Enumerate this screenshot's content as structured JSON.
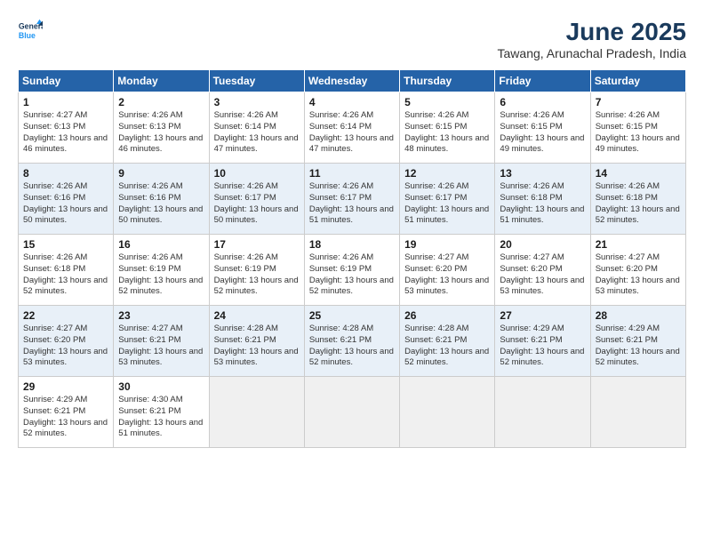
{
  "logo": {
    "line1": "General",
    "line2": "Blue"
  },
  "title": "June 2025",
  "location": "Tawang, Arunachal Pradesh, India",
  "headers": [
    "Sunday",
    "Monday",
    "Tuesday",
    "Wednesday",
    "Thursday",
    "Friday",
    "Saturday"
  ],
  "weeks": [
    [
      {
        "day": "1",
        "info": "Sunrise: 4:27 AM\nSunset: 6:13 PM\nDaylight: 13 hours and 46 minutes."
      },
      {
        "day": "2",
        "info": "Sunrise: 4:26 AM\nSunset: 6:13 PM\nDaylight: 13 hours and 46 minutes."
      },
      {
        "day": "3",
        "info": "Sunrise: 4:26 AM\nSunset: 6:14 PM\nDaylight: 13 hours and 47 minutes."
      },
      {
        "day": "4",
        "info": "Sunrise: 4:26 AM\nSunset: 6:14 PM\nDaylight: 13 hours and 47 minutes."
      },
      {
        "day": "5",
        "info": "Sunrise: 4:26 AM\nSunset: 6:15 PM\nDaylight: 13 hours and 48 minutes."
      },
      {
        "day": "6",
        "info": "Sunrise: 4:26 AM\nSunset: 6:15 PM\nDaylight: 13 hours and 49 minutes."
      },
      {
        "day": "7",
        "info": "Sunrise: 4:26 AM\nSunset: 6:15 PM\nDaylight: 13 hours and 49 minutes."
      }
    ],
    [
      {
        "day": "8",
        "info": "Sunrise: 4:26 AM\nSunset: 6:16 PM\nDaylight: 13 hours and 50 minutes."
      },
      {
        "day": "9",
        "info": "Sunrise: 4:26 AM\nSunset: 6:16 PM\nDaylight: 13 hours and 50 minutes."
      },
      {
        "day": "10",
        "info": "Sunrise: 4:26 AM\nSunset: 6:17 PM\nDaylight: 13 hours and 50 minutes."
      },
      {
        "day": "11",
        "info": "Sunrise: 4:26 AM\nSunset: 6:17 PM\nDaylight: 13 hours and 51 minutes."
      },
      {
        "day": "12",
        "info": "Sunrise: 4:26 AM\nSunset: 6:17 PM\nDaylight: 13 hours and 51 minutes."
      },
      {
        "day": "13",
        "info": "Sunrise: 4:26 AM\nSunset: 6:18 PM\nDaylight: 13 hours and 51 minutes."
      },
      {
        "day": "14",
        "info": "Sunrise: 4:26 AM\nSunset: 6:18 PM\nDaylight: 13 hours and 52 minutes."
      }
    ],
    [
      {
        "day": "15",
        "info": "Sunrise: 4:26 AM\nSunset: 6:18 PM\nDaylight: 13 hours and 52 minutes."
      },
      {
        "day": "16",
        "info": "Sunrise: 4:26 AM\nSunset: 6:19 PM\nDaylight: 13 hours and 52 minutes."
      },
      {
        "day": "17",
        "info": "Sunrise: 4:26 AM\nSunset: 6:19 PM\nDaylight: 13 hours and 52 minutes."
      },
      {
        "day": "18",
        "info": "Sunrise: 4:26 AM\nSunset: 6:19 PM\nDaylight: 13 hours and 52 minutes."
      },
      {
        "day": "19",
        "info": "Sunrise: 4:27 AM\nSunset: 6:20 PM\nDaylight: 13 hours and 53 minutes."
      },
      {
        "day": "20",
        "info": "Sunrise: 4:27 AM\nSunset: 6:20 PM\nDaylight: 13 hours and 53 minutes."
      },
      {
        "day": "21",
        "info": "Sunrise: 4:27 AM\nSunset: 6:20 PM\nDaylight: 13 hours and 53 minutes."
      }
    ],
    [
      {
        "day": "22",
        "info": "Sunrise: 4:27 AM\nSunset: 6:20 PM\nDaylight: 13 hours and 53 minutes."
      },
      {
        "day": "23",
        "info": "Sunrise: 4:27 AM\nSunset: 6:21 PM\nDaylight: 13 hours and 53 minutes."
      },
      {
        "day": "24",
        "info": "Sunrise: 4:28 AM\nSunset: 6:21 PM\nDaylight: 13 hours and 53 minutes."
      },
      {
        "day": "25",
        "info": "Sunrise: 4:28 AM\nSunset: 6:21 PM\nDaylight: 13 hours and 52 minutes."
      },
      {
        "day": "26",
        "info": "Sunrise: 4:28 AM\nSunset: 6:21 PM\nDaylight: 13 hours and 52 minutes."
      },
      {
        "day": "27",
        "info": "Sunrise: 4:29 AM\nSunset: 6:21 PM\nDaylight: 13 hours and 52 minutes."
      },
      {
        "day": "28",
        "info": "Sunrise: 4:29 AM\nSunset: 6:21 PM\nDaylight: 13 hours and 52 minutes."
      }
    ],
    [
      {
        "day": "29",
        "info": "Sunrise: 4:29 AM\nSunset: 6:21 PM\nDaylight: 13 hours and 52 minutes."
      },
      {
        "day": "30",
        "info": "Sunrise: 4:30 AM\nSunset: 6:21 PM\nDaylight: 13 hours and 51 minutes."
      },
      {
        "day": "",
        "info": ""
      },
      {
        "day": "",
        "info": ""
      },
      {
        "day": "",
        "info": ""
      },
      {
        "day": "",
        "info": ""
      },
      {
        "day": "",
        "info": ""
      }
    ]
  ]
}
